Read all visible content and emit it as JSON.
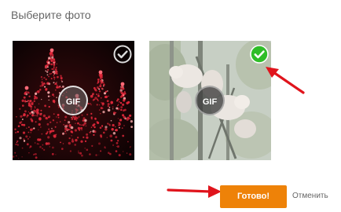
{
  "dialog": {
    "title": "Выберите фото"
  },
  "photos": [
    {
      "subject": "christmas-trees-lights",
      "badge": "GIF",
      "selected": false
    },
    {
      "subject": "cats-on-tree",
      "badge": "GIF",
      "selected": true
    }
  ],
  "footer": {
    "done_label": "Готово!",
    "cancel_label": "Отменить"
  },
  "colors": {
    "accent": "#ee8208",
    "check_selected": "#2fbd28",
    "annotation_arrow": "#e0141c",
    "title_text": "#666666"
  },
  "icons": {
    "selected_check": "check-circle-icon",
    "unselected_check": "check-circle-outline-icon",
    "annotation": "red-arrow-icon"
  }
}
